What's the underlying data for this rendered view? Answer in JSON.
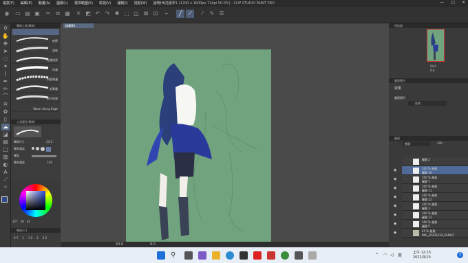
{
  "window": {
    "title": "插畫學1 (1200 x 1600px 72dpi 50.0%) - CLIP STUDIO PAINT PRO",
    "menu": [
      "檔案(F)",
      "編輯(E)",
      "動畫(A)",
      "圖層(L)",
      "選擇範圍(S)",
      "檢視(V)",
      "濾鏡(I)",
      "視窗(W)",
      "說明(H)"
    ],
    "controls": [
      "—",
      "□",
      "✕"
    ]
  },
  "document": {
    "tab_label": "插畫學1"
  },
  "subtool": {
    "group_header": "筆刷工具(筆刷)",
    "brushes": [
      "乾擦",
      "柔軟",
      "乾燥效果",
      "咕嚕",
      "四處噴灑",
      "毛筆畫",
      "刷子效果",
      "Water Along Edge"
    ]
  },
  "tool_property": {
    "header": "工具屬性(筆刷)",
    "rows": [
      {
        "label": "筆刷尺寸",
        "value": "23.0"
      },
      {
        "label": "筆刷濃度",
        "value": ""
      },
      {
        "label": "硬度",
        "value": ""
      },
      {
        "label": "筆刷濃度",
        "value": "100"
      }
    ]
  },
  "color": {
    "values": [
      "227",
      "58",
      "42"
    ]
  },
  "bottom_panel": {
    "header": "筆刷尺寸",
    "sizes": [
      "0.7",
      "1",
      "1.5",
      "2",
      "2.5"
    ]
  },
  "navigator": {
    "header": "導航器",
    "zoom": "50.0",
    "angle": "0.0"
  },
  "effects": {
    "header": "圖層屬性",
    "section_label": "效果",
    "color_label": "圖層顏色",
    "color_value": "彩色"
  },
  "layers": {
    "header": "圖層",
    "blend_mode": "普通",
    "opacity": "100",
    "items": [
      {
        "line1": "圖層 2",
        "line2": ""
      },
      {
        "line1": "100 % 普通",
        "line2": "圖層 10"
      },
      {
        "line1": "100 % 普通",
        "line2": "圖層 7"
      },
      {
        "line1": "100 % 普通",
        "line2": "圖層 11"
      },
      {
        "line1": "100 % 普通",
        "line2": "圖層 22"
      },
      {
        "line1": "100 % 普通",
        "line2": "圖層 3"
      },
      {
        "line1": "100 % 普通",
        "line2": "圖層 12"
      },
      {
        "line1": "100 % 普通",
        "line2": "圖層 5"
      },
      {
        "line1": "25 % 普通",
        "line2": "IMG_20220310_014047"
      }
    ]
  },
  "statusbar": {
    "zoom": "50.0",
    "angle": "0.0"
  },
  "taskbar": {
    "ime": "英",
    "time": "上午 12:15",
    "date": "2022/3/10",
    "notification_count": "3"
  }
}
